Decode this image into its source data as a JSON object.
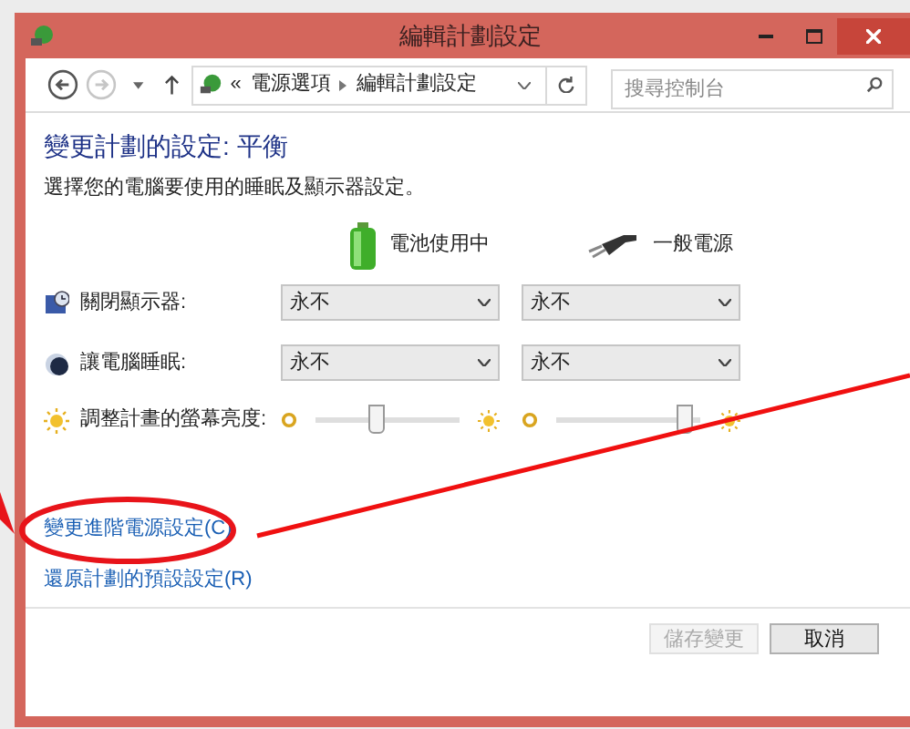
{
  "window": {
    "title": "編輯計劃設定"
  },
  "nav": {
    "buttons": [
      {
        "kind": "back",
        "disabled": false
      },
      {
        "kind": "forward",
        "disabled": true
      }
    ],
    "breadcrumb": [
      "«",
      "電源選項",
      "編輯計劃設定"
    ],
    "search": {
      "placeholder": "搜尋控制台"
    }
  },
  "heading": "變更計劃的設定: 平衡",
  "description": "選擇您的電腦要使用的睡眠及顯示器設定。",
  "columns": [
    {
      "kind": "battery",
      "label": "電池使用中"
    },
    {
      "kind": "plug",
      "label": "一般電源"
    }
  ],
  "settings": [
    {
      "kind": "dropdown",
      "label": "關閉顯示器:",
      "values": [
        "永不",
        "永不"
      ]
    },
    {
      "kind": "dropdown",
      "label": "讓電腦睡眠:",
      "values": [
        "永不",
        "永不"
      ]
    },
    {
      "kind": "slider",
      "label": "調整計畫的螢幕亮度:",
      "sliders": [
        {
          "level": 0.42
        },
        {
          "level": 0.88
        }
      ]
    }
  ],
  "links": [
    "變更進階電源設定(C)",
    "還原計劃的預設設定(R)"
  ],
  "buttons": [
    {
      "label": "儲存變更",
      "disabled": true
    },
    {
      "label": "取消",
      "disabled": false
    }
  ]
}
